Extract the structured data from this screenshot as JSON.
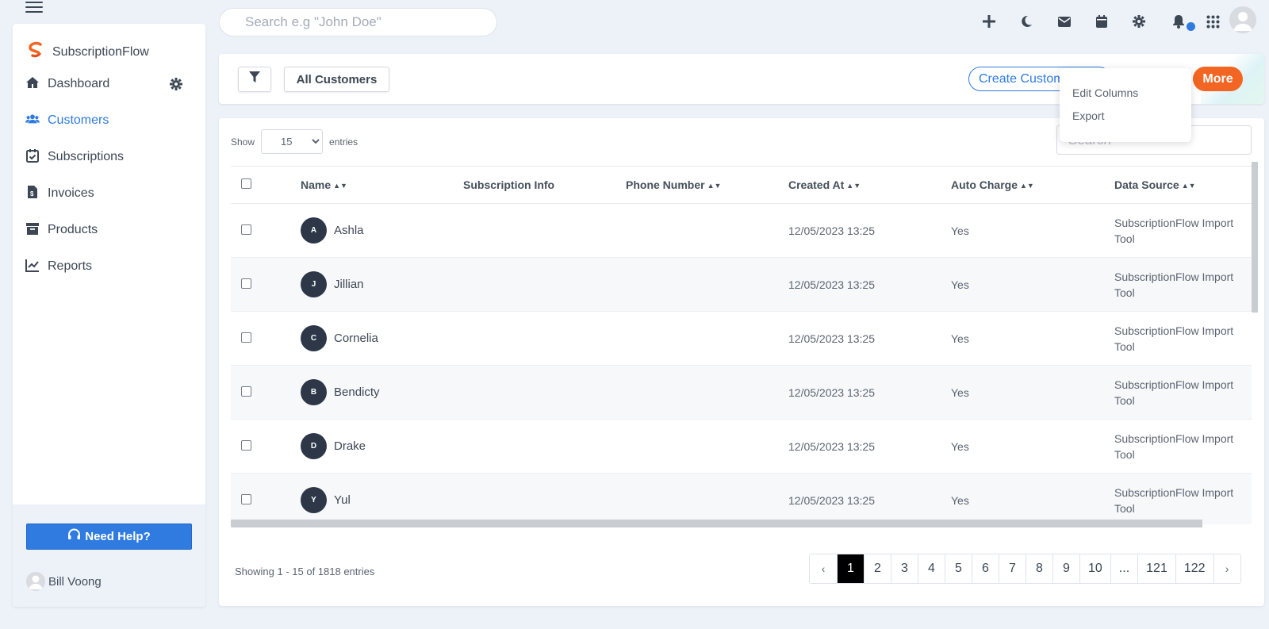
{
  "topbar": {
    "search_placeholder": "Search e.g \"John Doe\""
  },
  "sidebar": {
    "brand": "SubscriptionFlow",
    "items": [
      {
        "label": "Dashboard",
        "icon": "home-icon",
        "active": false
      },
      {
        "label": "Customers",
        "icon": "users-icon",
        "active": true
      },
      {
        "label": "Subscriptions",
        "icon": "calendar-check-icon",
        "active": false
      },
      {
        "label": "Invoices",
        "icon": "invoice-icon",
        "active": false
      },
      {
        "label": "Products",
        "icon": "archive-icon",
        "active": false
      },
      {
        "label": "Reports",
        "icon": "chart-line-icon",
        "active": false
      }
    ],
    "help_label": "Need Help?",
    "user_name": "Bill Voong"
  },
  "toolbar": {
    "view_label": "All Customers",
    "create_label": "Create Customer",
    "more_label": "More"
  },
  "dropdown": {
    "items": [
      "Edit Columns",
      "Export"
    ]
  },
  "table": {
    "show_label": "Show",
    "entries_label": "entries",
    "page_size": "15",
    "search_placeholder": "Search",
    "columns": [
      "Name",
      "Subscription Info",
      "Phone Number",
      "Created At",
      "Auto Charge",
      "Data Source"
    ],
    "rows": [
      {
        "initial": "A",
        "name": "Ashla",
        "subscription_info": "",
        "phone": "",
        "created_at": "12/05/2023 13:25",
        "auto_charge": "Yes",
        "data_source_1": "SubscriptionFlow Import",
        "data_source_2": "Tool"
      },
      {
        "initial": "J",
        "name": "Jillian",
        "subscription_info": "",
        "phone": "",
        "created_at": "12/05/2023 13:25",
        "auto_charge": "Yes",
        "data_source_1": "SubscriptionFlow Import",
        "data_source_2": "Tool"
      },
      {
        "initial": "C",
        "name": "Cornelia",
        "subscription_info": "",
        "phone": "",
        "created_at": "12/05/2023 13:25",
        "auto_charge": "Yes",
        "data_source_1": "SubscriptionFlow Import",
        "data_source_2": "Tool"
      },
      {
        "initial": "B",
        "name": "Bendicty",
        "subscription_info": "",
        "phone": "",
        "created_at": "12/05/2023 13:25",
        "auto_charge": "Yes",
        "data_source_1": "SubscriptionFlow Import",
        "data_source_2": "Tool"
      },
      {
        "initial": "D",
        "name": "Drake",
        "subscription_info": "",
        "phone": "",
        "created_at": "12/05/2023 13:25",
        "auto_charge": "Yes",
        "data_source_1": "SubscriptionFlow Import",
        "data_source_2": "Tool"
      },
      {
        "initial": "Y",
        "name": "Yul",
        "subscription_info": "",
        "phone": "",
        "created_at": "12/05/2023 13:25",
        "auto_charge": "Yes",
        "data_source_1": "SubscriptionFlow Import",
        "data_source_2": "Tool"
      }
    ],
    "info": "Showing 1 - 15 of 1818 entries",
    "pages": [
      "‹",
      "1",
      "2",
      "3",
      "4",
      "5",
      "6",
      "7",
      "8",
      "9",
      "10",
      "...",
      "121",
      "122",
      "›"
    ],
    "current_page": "1"
  },
  "colors": {
    "accent": "#2f7be0",
    "more_button": "#f26522",
    "avatar_bg": "#2d3748",
    "page_bg": "#edf1f8"
  }
}
